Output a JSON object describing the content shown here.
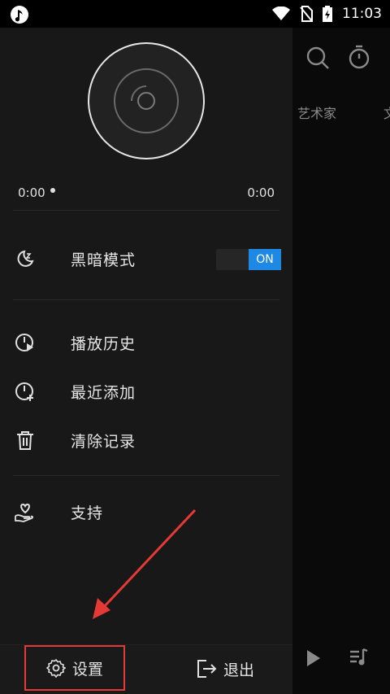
{
  "status_bar": {
    "time": "11:03"
  },
  "background_screen": {
    "tabs": [
      "艺术家",
      "文"
    ]
  },
  "player": {
    "current_time": "0:00",
    "total_time": "0:00",
    "progress": 0
  },
  "menu": {
    "dark_mode": {
      "label": "黑暗模式",
      "toggle_state": "ON"
    },
    "history": {
      "label": "播放历史"
    },
    "recent": {
      "label": "最近添加"
    },
    "clear": {
      "label": "清除记录"
    },
    "support": {
      "label": "支持"
    }
  },
  "bottom": {
    "settings_label": "设置",
    "exit_label": "退出"
  },
  "colors": {
    "accent": "#1e88e5",
    "highlight": "#e53935"
  }
}
